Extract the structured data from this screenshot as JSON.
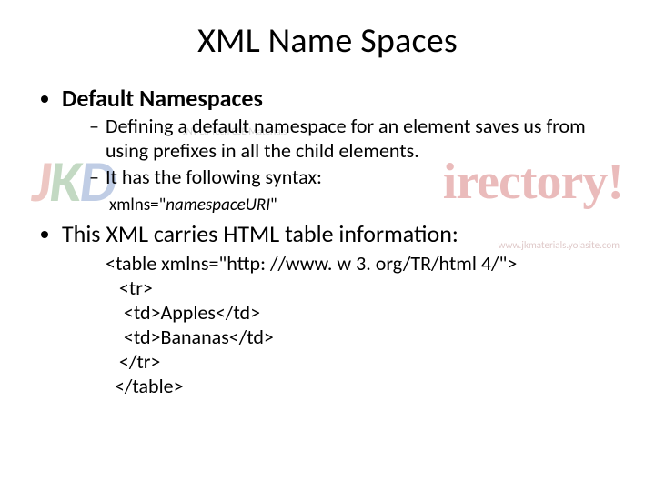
{
  "title": "XML Name Spaces",
  "bullets": {
    "default_ns": "Default Namespaces",
    "sub1": "Defining a default namespace for an element saves us from using prefixes in all the child elements.",
    "sub2": "It has the following syntax:",
    "syntax_prefix": "xmlns=\"",
    "syntax_uri": "namespaceURI",
    "syntax_suffix": "\"",
    "carries": "This XML carries HTML table information:"
  },
  "code": "<table xmlns=\"http: //www. w 3. org/TR/html 4/\">\n   <tr>\n    <td>Apples</td>\n    <td>Bananas</td>\n   </tr>\n  </table>",
  "watermark": {
    "jkd_j": "J",
    "jkd_k": "K",
    "jkd_d": "D",
    "sub": "JNT La Tech CSE Materials",
    "right": "irectory!",
    "url": "www.jkmaterials.yolasite.com"
  }
}
